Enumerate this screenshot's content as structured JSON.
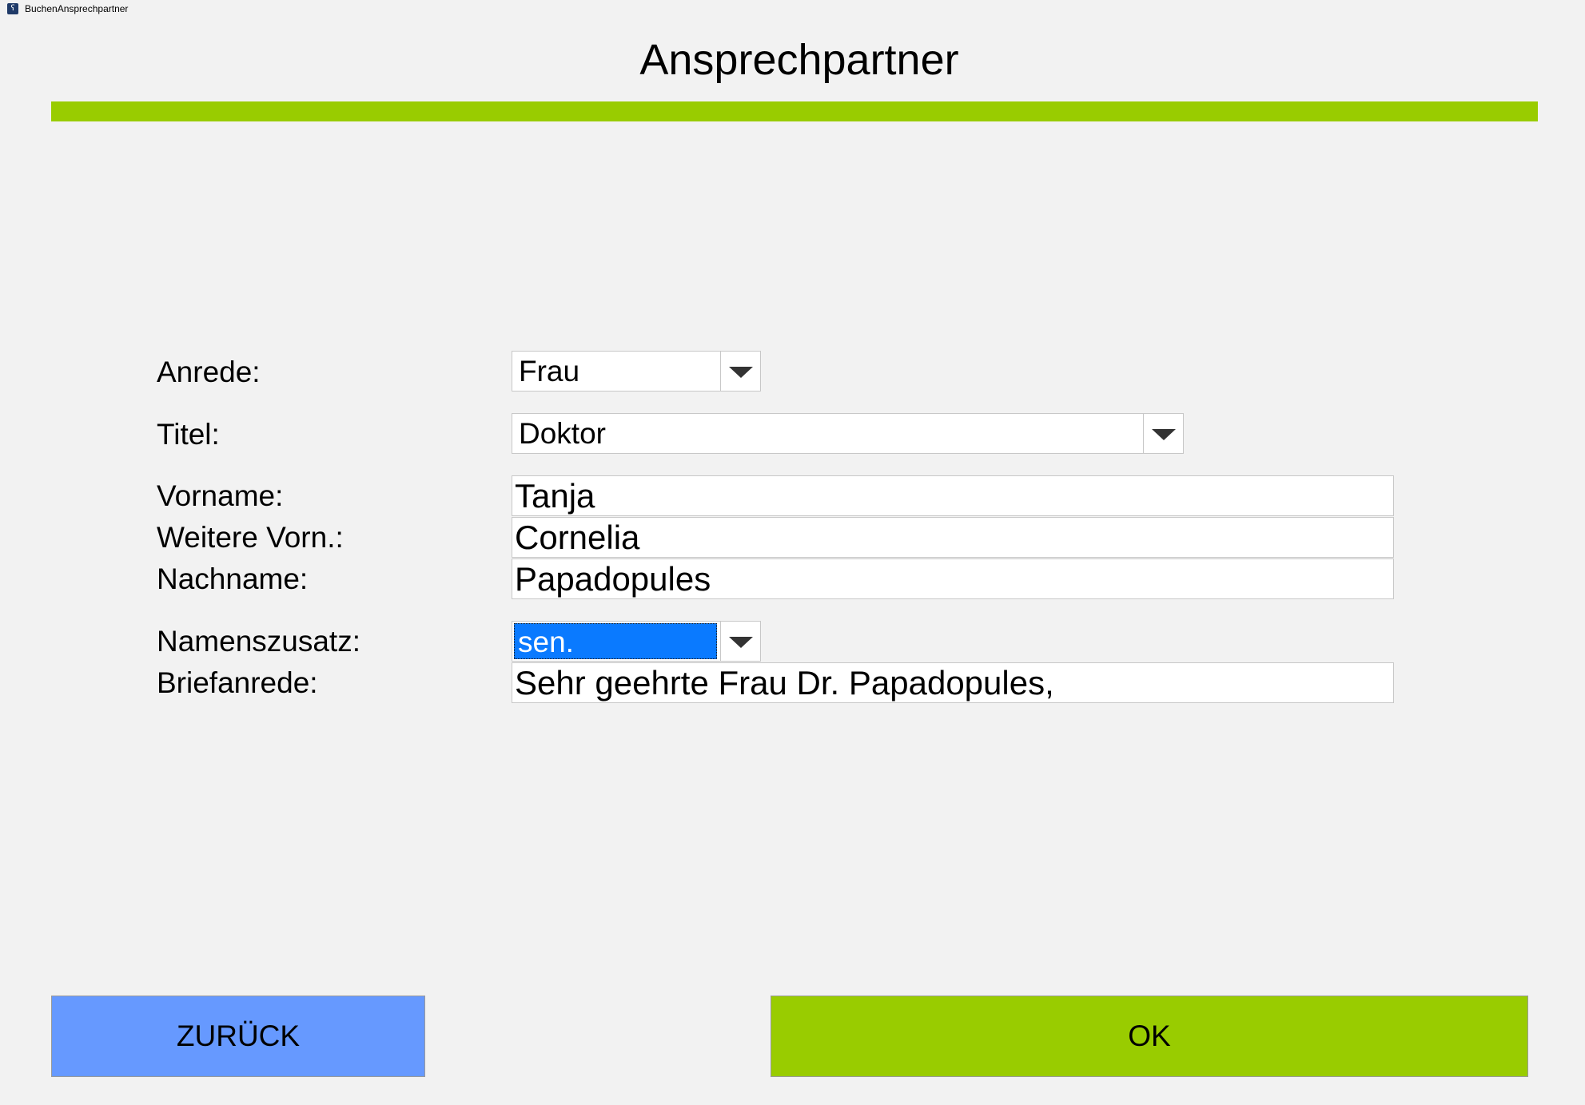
{
  "window": {
    "title": "BuchenAnsprechpartner",
    "icon_name": "app-icon",
    "icon_glyph": "ʕ"
  },
  "header": {
    "title": "Ansprechpartner",
    "accent_color": "#99cc00"
  },
  "form": {
    "anrede": {
      "label": "Anrede:",
      "value": "Frau"
    },
    "titel": {
      "label": "Titel:",
      "value": "Doktor"
    },
    "vorname": {
      "label": "Vorname:",
      "value": "Tanja"
    },
    "weitere_vornamen": {
      "label": "Weitere Vorn.:",
      "value": "Cornelia"
    },
    "nachname": {
      "label": "Nachname:",
      "value": "Papadopules"
    },
    "namenszusatz": {
      "label": "Namenszusatz:",
      "value": "sen."
    },
    "briefanrede": {
      "label": "Briefanrede:",
      "value": "Sehr geehrte Frau Dr. Papadopules,"
    }
  },
  "buttons": {
    "back": {
      "label": "ZURÜCK",
      "color": "#6699ff"
    },
    "ok": {
      "label": "OK",
      "color": "#99cc00"
    }
  }
}
